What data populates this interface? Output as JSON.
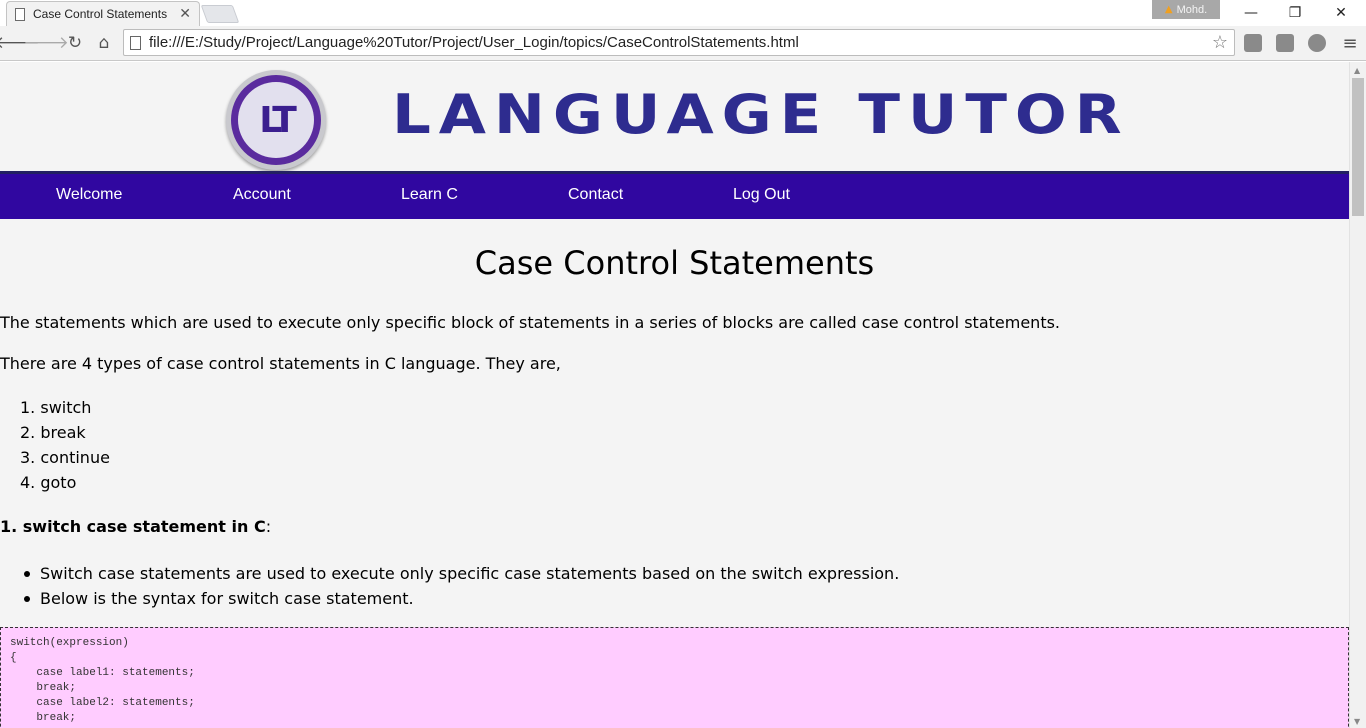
{
  "browser": {
    "tab_title": "Case Control Statements",
    "tab_close": "✕",
    "profile_name": "Mohd.",
    "url": "file:///E:/Study/Project/Language%20Tutor/Project/User_Login/topics/CaseControlStatements.html",
    "window_controls": {
      "minimize": "—",
      "restore": "❐",
      "close": "✕"
    },
    "nav_icons": [
      "back-icon",
      "forward-icon",
      "reload-icon",
      "home-icon"
    ]
  },
  "site": {
    "logo_text": "LT",
    "title": "LANGUAGE TUTOR",
    "nav": [
      "Welcome",
      "Account",
      "Learn C",
      "Contact",
      "Log Out"
    ]
  },
  "article": {
    "title": "Case Control Statements",
    "intro": "The statements which are used to execute only specific block of statements in a series of blocks are called case control statements.",
    "types_intro": "There are 4 types of case control statements in C language. They are,",
    "types": [
      "switch",
      "break",
      "continue",
      "goto"
    ],
    "section1_heading": "1. switch case statement in C",
    "section1_colon": ":",
    "section1_points": [
      "Switch case statements are used to execute only specific case statements based on the switch expression.",
      "Below is the syntax for switch case statement."
    ],
    "code_lines": [
      "switch(expression)",
      "{",
      "    case label1: statements;",
      "    break;",
      "    case label2: statements;",
      "    break;"
    ]
  },
  "colors": {
    "nav_bg": "#3007a0",
    "title_color": "#2e2c8f",
    "code_bg": "#ffccff"
  }
}
